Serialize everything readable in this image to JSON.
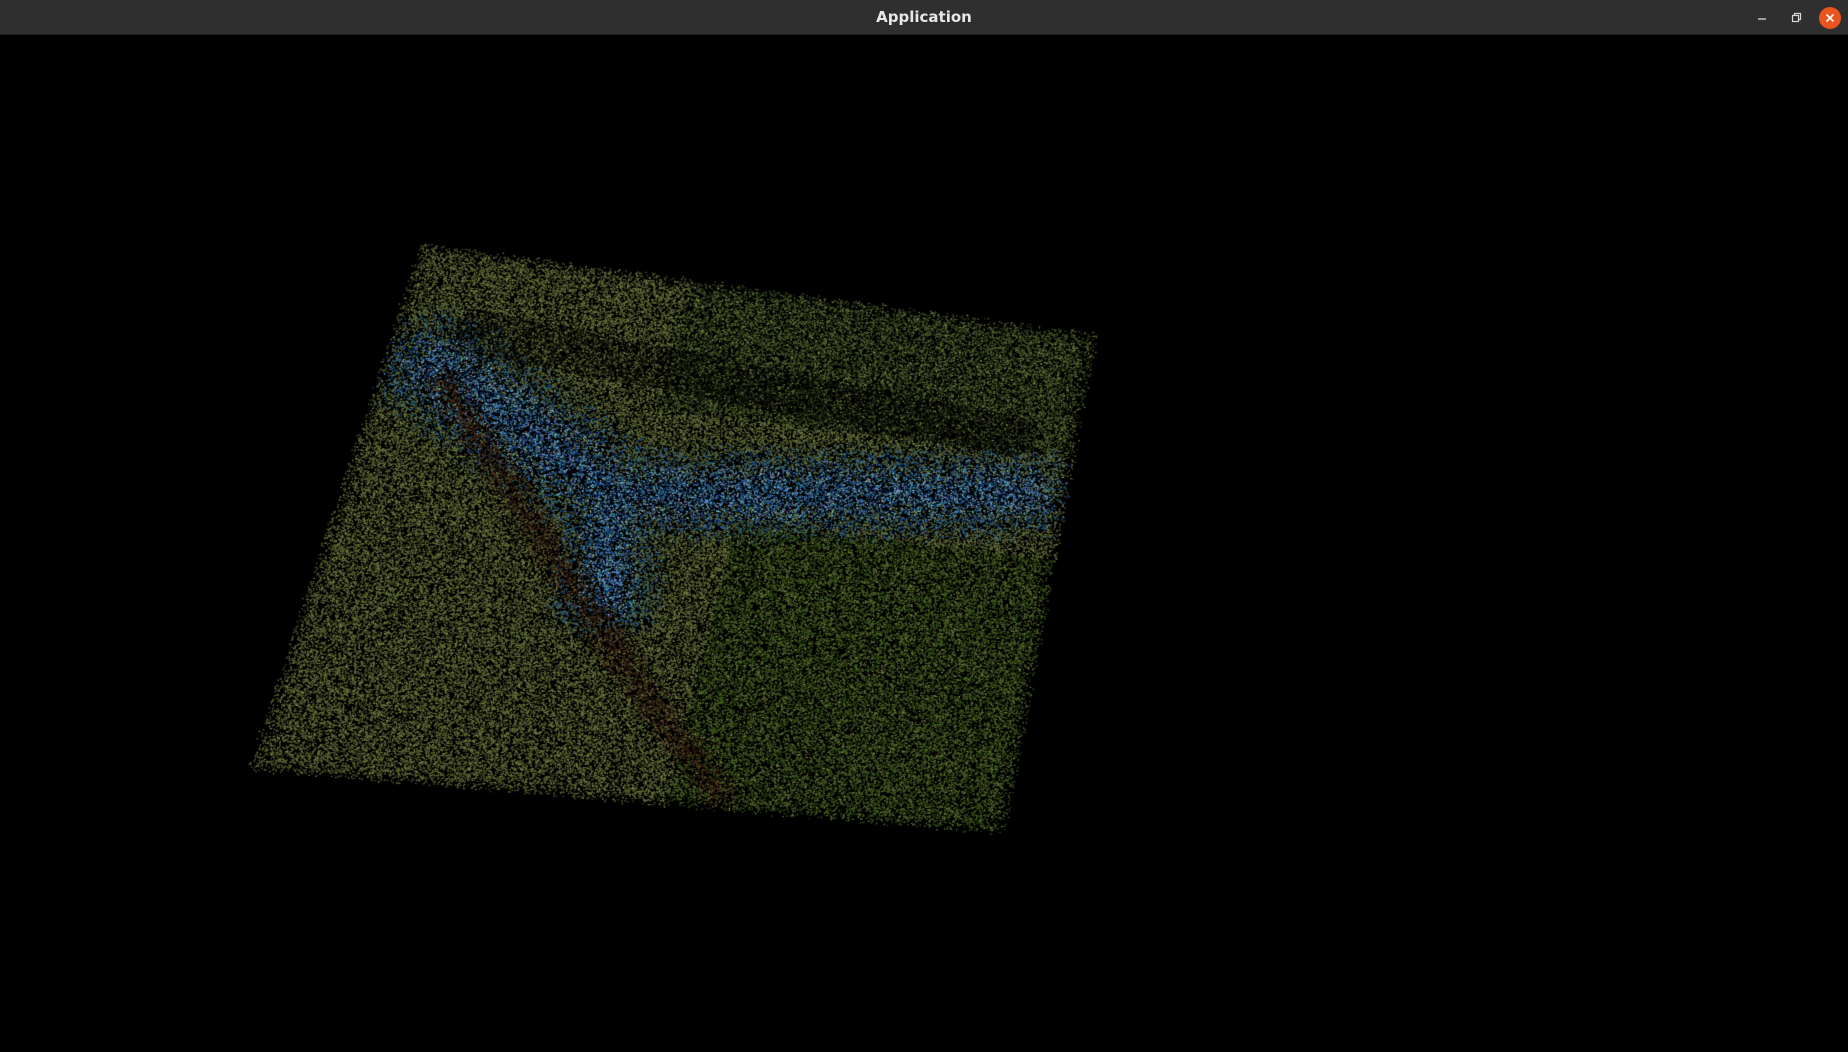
{
  "window": {
    "title": "Application"
  },
  "colors": {
    "titlebar": "#2f2f2f",
    "title_text": "#e8e8e8",
    "close_button": "#e9541f",
    "background": "#000000",
    "cloud_olive": "#8c9a4a",
    "cloud_dark_green": "#3e5a1c",
    "cloud_blue": "#3c8fd0",
    "cloud_cyan": "#a8e0f0",
    "cloud_brown": "#5a3a22"
  },
  "icons": {
    "minimize": "minimize-icon",
    "maximize": "restore-icon",
    "close": "close-icon"
  }
}
